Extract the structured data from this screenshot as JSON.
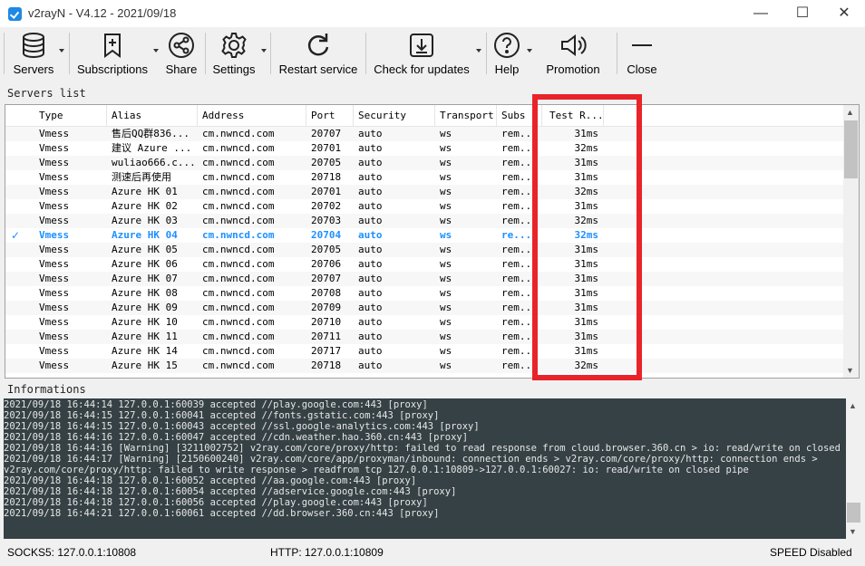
{
  "window": {
    "title": "v2rayN - V4.12 - 2021/09/18",
    "minimize": "—",
    "maximize": "☐",
    "close": "✕"
  },
  "toolbar": {
    "servers": "Servers",
    "subscriptions": "Subscriptions",
    "share": "Share",
    "settings": "Settings",
    "restart": "Restart service",
    "check_updates": "Check for updates",
    "help": "Help",
    "promotion": "Promotion",
    "close": "Close"
  },
  "servers_list": {
    "label": "Servers list",
    "columns": [
      "Type",
      "Alias",
      "Address",
      "Port",
      "Security",
      "Transport",
      "Subs",
      "Test R..."
    ],
    "rows": [
      [
        "Vmess",
        "售后QQ群836...",
        "cm.nwncd.com",
        "20707",
        "auto",
        "ws",
        "rem...",
        "31ms"
      ],
      [
        "Vmess",
        "建议 Azure ...",
        "cm.nwncd.com",
        "20701",
        "auto",
        "ws",
        "rem...",
        "32ms"
      ],
      [
        "Vmess",
        "wuliao666.c...",
        "cm.nwncd.com",
        "20705",
        "auto",
        "ws",
        "rem...",
        "31ms"
      ],
      [
        "Vmess",
        "测速后再使用",
        "cm.nwncd.com",
        "20718",
        "auto",
        "ws",
        "rem...",
        "31ms"
      ],
      [
        "Vmess",
        "Azure HK 01",
        "cm.nwncd.com",
        "20701",
        "auto",
        "ws",
        "rem...",
        "32ms"
      ],
      [
        "Vmess",
        "Azure HK 02",
        "cm.nwncd.com",
        "20702",
        "auto",
        "ws",
        "rem...",
        "31ms"
      ],
      [
        "Vmess",
        "Azure HK 03",
        "cm.nwncd.com",
        "20703",
        "auto",
        "ws",
        "rem...",
        "32ms"
      ],
      [
        "Vmess",
        "Azure HK 04",
        "cm.nwncd.com",
        "20704",
        "auto",
        "ws",
        "re...",
        "32ms"
      ],
      [
        "Vmess",
        "Azure HK 05",
        "cm.nwncd.com",
        "20705",
        "auto",
        "ws",
        "rem...",
        "31ms"
      ],
      [
        "Vmess",
        "Azure HK 06",
        "cm.nwncd.com",
        "20706",
        "auto",
        "ws",
        "rem...",
        "31ms"
      ],
      [
        "Vmess",
        "Azure HK 07",
        "cm.nwncd.com",
        "20707",
        "auto",
        "ws",
        "rem...",
        "31ms"
      ],
      [
        "Vmess",
        "Azure HK 08",
        "cm.nwncd.com",
        "20708",
        "auto",
        "ws",
        "rem...",
        "31ms"
      ],
      [
        "Vmess",
        "Azure HK 09",
        "cm.nwncd.com",
        "20709",
        "auto",
        "ws",
        "rem...",
        "31ms"
      ],
      [
        "Vmess",
        "Azure HK 10",
        "cm.nwncd.com",
        "20710",
        "auto",
        "ws",
        "rem...",
        "31ms"
      ],
      [
        "Vmess",
        "Azure HK 11",
        "cm.nwncd.com",
        "20711",
        "auto",
        "ws",
        "rem...",
        "31ms"
      ],
      [
        "Vmess",
        "Azure HK 14",
        "cm.nwncd.com",
        "20717",
        "auto",
        "ws",
        "rem...",
        "31ms"
      ],
      [
        "Vmess",
        "Azure HK 15",
        "cm.nwncd.com",
        "20718",
        "auto",
        "ws",
        "rem...",
        "32ms"
      ]
    ],
    "selected_index": 7,
    "selected_mark": "✓"
  },
  "informations": {
    "label": "Informations",
    "lines": [
      "2021/09/18 16:44:14 127.0.0.1:60039 accepted //play.google.com:443 [proxy]",
      "2021/09/18 16:44:15 127.0.0.1:60041 accepted //fonts.gstatic.com:443 [proxy]",
      "2021/09/18 16:44:15 127.0.0.1:60043 accepted //ssl.google-analytics.com:443 [proxy]",
      "2021/09/18 16:44:16 127.0.0.1:60047 accepted //cdn.weather.hao.360.cn:443 [proxy]",
      "2021/09/18 16:44:16 [Warning] [3211002752] v2ray.com/core/proxy/http: failed to read response from cloud.browser.360.cn > io: read/write on closed pipe",
      "2021/09/18 16:44:17 [Warning] [2150600240] v2ray.com/core/app/proxyman/inbound: connection ends > v2ray.com/core/proxy/http: connection ends >",
      "v2ray.com/core/proxy/http: failed to write response > readfrom tcp 127.0.0.1:10809->127.0.0.1:60027: io: read/write on closed pipe",
      "2021/09/18 16:44:18 127.0.0.1:60052 accepted //aa.google.com:443 [proxy]",
      "2021/09/18 16:44:18 127.0.0.1:60054 accepted //adservice.google.com:443 [proxy]",
      "2021/09/18 16:44:18 127.0.0.1:60056 accepted //play.google.com:443 [proxy]",
      "2021/09/18 16:44:21 127.0.0.1:60061 accepted //dd.browser.360.cn:443 [proxy]"
    ]
  },
  "status": {
    "socks": "SOCKS5:  127.0.0.1:10808",
    "http": "HTTP:  127.0.0.1:10809",
    "speed": "SPEED Disabled"
  },
  "colors": {
    "accent": "#1e90ff",
    "highlight": "#e8242a",
    "log_bg": "#364145"
  },
  "icons": {
    "servers": "database-icon",
    "subscriptions": "bookmark-plus-icon",
    "share": "share-icon",
    "settings": "gear-icon",
    "restart": "refresh-icon",
    "updates": "download-icon",
    "help": "help-icon",
    "promotion": "speaker-icon",
    "close": "minus-icon"
  }
}
